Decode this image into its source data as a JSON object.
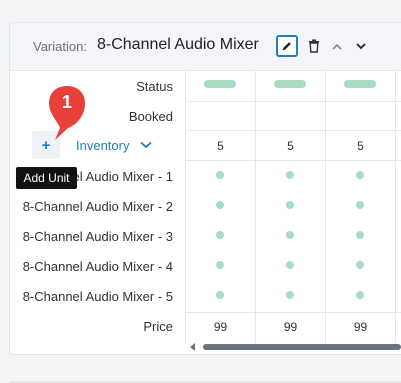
{
  "header": {
    "variation_label": "Variation:",
    "variation_name": "8-Channel Audio Mixer"
  },
  "rows": {
    "status": "Status",
    "booked": "Booked",
    "inventory": "Inventory",
    "units": [
      "8-Channel Audio Mixer - 1",
      "8-Channel Audio Mixer - 2",
      "8-Channel Audio Mixer - 3",
      "8-Channel Audio Mixer - 4",
      "8-Channel Audio Mixer - 5"
    ],
    "price": "Price"
  },
  "columns": [
    {
      "inventory": "5",
      "price": "99"
    },
    {
      "inventory": "5",
      "price": "99"
    },
    {
      "inventory": "5",
      "price": "99"
    }
  ],
  "tooltip": "Add Unit",
  "badge_number": "1",
  "colors": {
    "accent": "#1f7fb8",
    "status_green": "#a8dcc2",
    "badge_red": "#e8413b"
  },
  "icons": [
    "pencil-icon",
    "trash-icon",
    "chevron-up-icon",
    "chevron-down-icon",
    "plus-icon"
  ]
}
